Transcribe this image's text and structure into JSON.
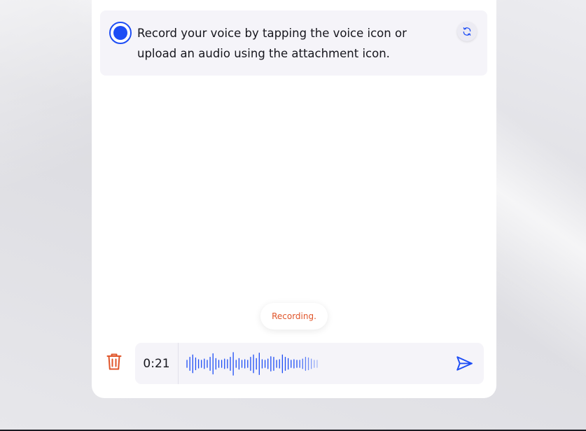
{
  "message": {
    "text": "Record your voice by tapping the voice icon or upload an audio using the attachment icon."
  },
  "status": {
    "label": "Recording."
  },
  "recorder": {
    "time": "0:21",
    "waveform_levels": [
      0.3,
      0.55,
      0.75,
      0.5,
      0.35,
      0.3,
      0.4,
      0.3,
      0.55,
      0.85,
      0.45,
      0.3,
      0.3,
      0.4,
      0.35,
      0.55,
      0.95,
      0.3,
      0.45,
      0.3,
      0.35,
      0.3,
      0.55,
      0.75,
      0.45,
      0.9,
      0.35,
      0.3,
      0.4,
      0.6,
      0.55,
      0.3,
      0.35,
      0.75,
      0.55,
      0.45,
      0.3,
      0.35,
      0.3,
      0.3,
      0.4,
      0.55,
      0.5,
      0.4,
      0.3,
      0.3
    ]
  },
  "colors": {
    "accent": "#1d4df5",
    "danger": "#e0552a",
    "card": "#ffffff",
    "panel": "#f5f4f9"
  }
}
